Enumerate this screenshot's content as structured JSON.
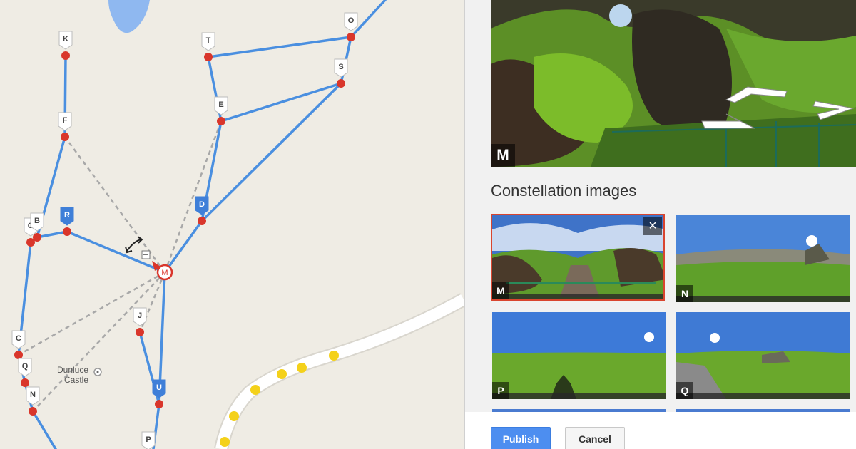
{
  "map": {
    "nodes": [
      {
        "id": "K",
        "label": "K"
      },
      {
        "id": "F",
        "label": "F"
      },
      {
        "id": "T",
        "label": "T"
      },
      {
        "id": "O",
        "label": "O"
      },
      {
        "id": "S",
        "label": "S"
      },
      {
        "id": "E",
        "label": "E"
      },
      {
        "id": "D",
        "label": "D"
      },
      {
        "id": "R",
        "label": "R"
      },
      {
        "id": "G",
        "label": "G"
      },
      {
        "id": "B",
        "label": "B"
      },
      {
        "id": "M",
        "label": "M"
      },
      {
        "id": "J",
        "label": "J"
      },
      {
        "id": "C",
        "label": "C"
      },
      {
        "id": "Q",
        "label": "Q"
      },
      {
        "id": "N",
        "label": "N"
      },
      {
        "id": "U",
        "label": "U"
      },
      {
        "id": "P",
        "label": "P"
      }
    ],
    "place_label_line1": "Dunluce",
    "place_label_line2": "Castle",
    "colors": {
      "link": "#4a8fe0",
      "node": "#d9362b",
      "road": "#ffffff",
      "road_dots": "#f4d11a",
      "dashed": "#a8a8a8"
    }
  },
  "panel": {
    "current_pano_label": "M",
    "section_title": "Constellation images",
    "thumbnails": [
      {
        "label": "M",
        "selected": true,
        "close_icon": "×"
      },
      {
        "label": "N",
        "selected": false
      },
      {
        "label": "P",
        "selected": false
      },
      {
        "label": "Q",
        "selected": false
      }
    ],
    "publish_label": "Publish",
    "cancel_label": "Cancel",
    "accent_color": "#d9452f",
    "primary_color": "#4d8ef0"
  }
}
